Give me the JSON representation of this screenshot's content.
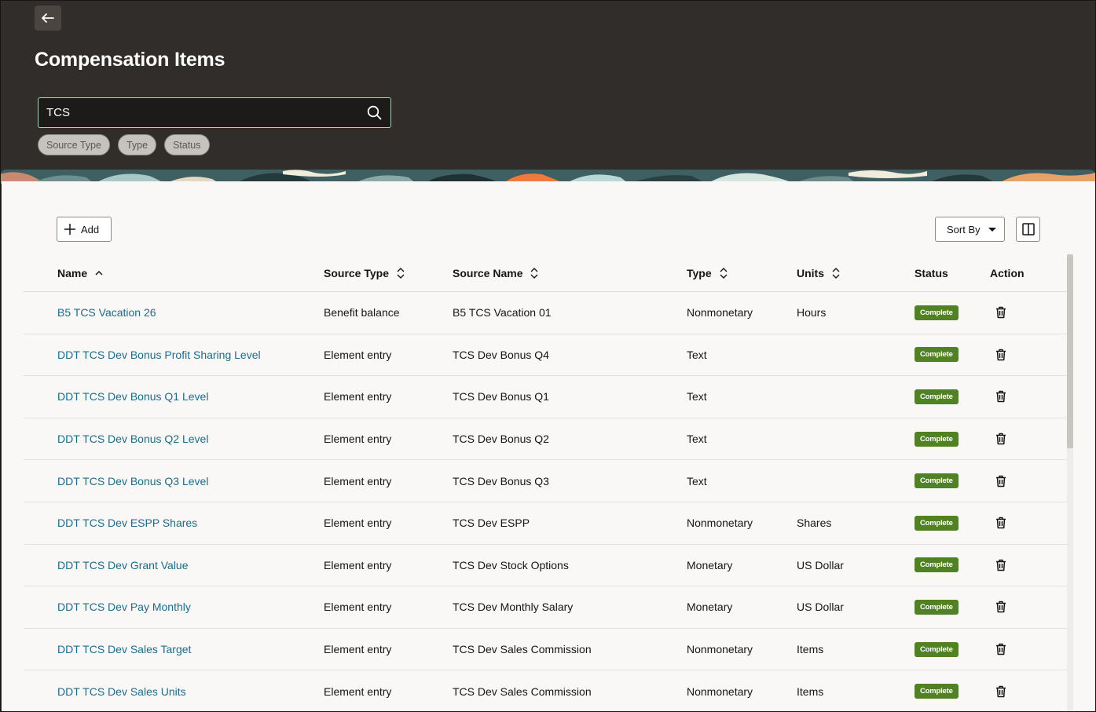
{
  "header": {
    "title": "Compensation Items",
    "search_value": "TCS",
    "filters": [
      "Source Type",
      "Type",
      "Status"
    ]
  },
  "toolbar": {
    "add_label": "Add",
    "sort_label": "Sort By"
  },
  "table": {
    "columns": {
      "name": "Name",
      "source_type": "Source Type",
      "source_name": "Source Name",
      "type": "Type",
      "units": "Units",
      "status": "Status",
      "action": "Action"
    },
    "rows": [
      {
        "name": "B5 TCS Vacation 26",
        "source_type": "Benefit balance",
        "source_name": "B5 TCS Vacation 01",
        "type": "Nonmonetary",
        "units": "Hours",
        "status": "Complete"
      },
      {
        "name": "DDT TCS Dev Bonus Profit Sharing Level",
        "source_type": "Element entry",
        "source_name": "TCS Dev Bonus Q4",
        "type": "Text",
        "units": "",
        "status": "Complete"
      },
      {
        "name": "DDT TCS Dev Bonus Q1 Level",
        "source_type": "Element entry",
        "source_name": "TCS Dev Bonus Q1",
        "type": "Text",
        "units": "",
        "status": "Complete"
      },
      {
        "name": "DDT TCS Dev Bonus Q2 Level",
        "source_type": "Element entry",
        "source_name": "TCS Dev Bonus Q2",
        "type": "Text",
        "units": "",
        "status": "Complete"
      },
      {
        "name": "DDT TCS Dev Bonus Q3 Level",
        "source_type": "Element entry",
        "source_name": "TCS Dev Bonus Q3",
        "type": "Text",
        "units": "",
        "status": "Complete"
      },
      {
        "name": "DDT TCS Dev ESPP Shares",
        "source_type": "Element entry",
        "source_name": "TCS Dev ESPP",
        "type": "Nonmonetary",
        "units": "Shares",
        "status": "Complete"
      },
      {
        "name": "DDT TCS Dev Grant Value",
        "source_type": "Element entry",
        "source_name": "TCS Dev Stock Options",
        "type": "Monetary",
        "units": "US Dollar",
        "status": "Complete"
      },
      {
        "name": "DDT TCS Dev Pay Monthly",
        "source_type": "Element entry",
        "source_name": "TCS Dev Monthly Salary",
        "type": "Monetary",
        "units": "US Dollar",
        "status": "Complete"
      },
      {
        "name": "DDT TCS Dev Sales Target",
        "source_type": "Element entry",
        "source_name": "TCS Dev Sales Commission",
        "type": "Nonmonetary",
        "units": "Items",
        "status": "Complete"
      },
      {
        "name": "DDT TCS Dev Sales Units",
        "source_type": "Element entry",
        "source_name": "TCS Dev Sales Commission",
        "type": "Nonmonetary",
        "units": "Items",
        "status": "Complete"
      }
    ]
  },
  "colors": {
    "header_bg": "#312d2a",
    "link": "#1d6b8a",
    "status_complete": "#508223",
    "panel_bg": "#f9f8f6"
  },
  "icons": [
    "back-arrow-icon",
    "search-icon",
    "plus-icon",
    "caret-down-icon",
    "columns-icon",
    "sort-ascending-icon",
    "sort-toggle-icon",
    "trash-icon"
  ]
}
